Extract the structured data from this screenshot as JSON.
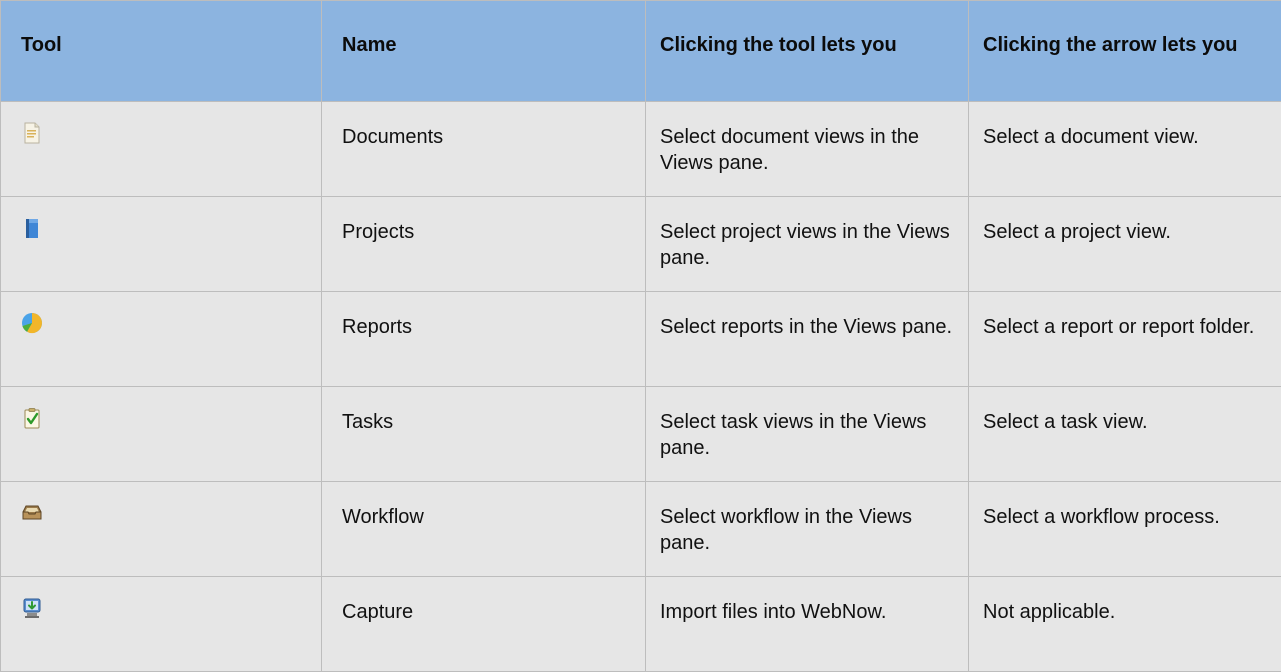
{
  "headers": {
    "tool": "Tool",
    "name": "Name",
    "tool_click": "Clicking the tool lets you",
    "arrow_click": "Clicking the arrow lets you"
  },
  "rows": [
    {
      "icon": "documents-icon",
      "name": "Documents",
      "tool_click": "Select document views in the Views pane.",
      "arrow_click": "Select a document view."
    },
    {
      "icon": "projects-icon",
      "name": "Projects",
      "tool_click": "Select project views in the Views pane.",
      "arrow_click": "Select a project view."
    },
    {
      "icon": "reports-icon",
      "name": "Reports",
      "tool_click": "Select reports in the Views pane.",
      "arrow_click": "Select a report or report folder."
    },
    {
      "icon": "tasks-icon",
      "name": "Tasks",
      "tool_click": "Select task views in the Views pane.",
      "arrow_click": "Select a task view."
    },
    {
      "icon": "workflow-icon",
      "name": "Workflow",
      "tool_click": "Select workflow in the Views pane.",
      "arrow_click": "Select a workflow process."
    },
    {
      "icon": "capture-icon",
      "name": "Capture",
      "tool_click": "Import files into WebNow.",
      "arrow_click": "Not applicable."
    }
  ],
  "colors": {
    "header_bg": "#8cb4e0",
    "cell_bg": "#e6e6e6",
    "border": "#bdbdbd"
  }
}
